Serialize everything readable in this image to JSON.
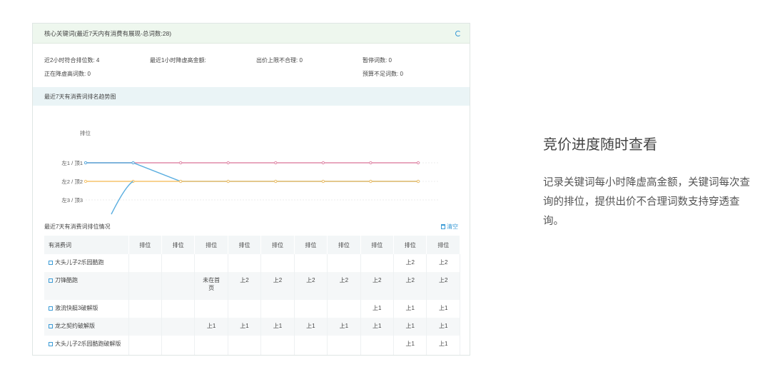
{
  "panel": {
    "title": "核心关键词(最近7天内有消费有展现-总词数:28)",
    "stats": {
      "rank_match": "近2小时符合排位数: 4",
      "bid_reduce_amount": "最近1小时降虚高金额:",
      "price_cap_invalid": "出价上限不合理: 0",
      "paused_words": "暂停词数: 0",
      "reducing_words": "正在降虚高词数: 0",
      "budget_short": "预算不足词数: 0"
    },
    "trend_section_title": "最近7天有消费词排名趋势图",
    "table_section_title": "最近7天有消费词排位情况",
    "clear_label": "清空"
  },
  "chart_data": {
    "type": "line",
    "ylabel": "排位",
    "y_ticks": [
      "左1 / 顶1",
      "左2 / 顶2",
      "左3 / 顶3"
    ],
    "series": [
      {
        "color": "#e08aa8",
        "values": [
          1,
          1,
          1,
          1,
          1,
          1,
          1,
          1
        ]
      },
      {
        "color": "#5aaee0",
        "values": [
          1,
          1,
          2,
          2,
          2,
          2,
          2,
          2
        ]
      },
      {
        "color": "#f5c36b",
        "values": [
          2,
          2,
          2,
          2,
          2,
          2,
          2,
          2
        ]
      }
    ]
  },
  "table": {
    "headers": [
      "有消费词",
      "排位",
      "排位",
      "排位",
      "排位",
      "排位",
      "排位",
      "排位",
      "排位",
      "排位",
      "排位"
    ],
    "rows": [
      [
        "大头儿子2乐园酷跑",
        "",
        "",
        "",
        "",
        "",
        "",
        "",
        "",
        "上2",
        "上2"
      ],
      [
        "刀锋酷跑",
        "",
        "",
        "未在首页",
        "上2",
        "上2",
        "上2",
        "上2",
        "上2",
        "上2",
        "上2"
      ],
      [
        "激流快艇3破解版",
        "",
        "",
        "",
        "",
        "",
        "",
        "",
        "上1",
        "上1",
        "上1"
      ],
      [
        "龙之契约破解版",
        "",
        "",
        "上1",
        "上1",
        "上1",
        "上1",
        "上1",
        "上1",
        "上1",
        "上1"
      ],
      [
        "大头儿子2乐园酷跑破解版",
        "",
        "",
        "",
        "",
        "",
        "",
        "",
        "",
        "上1",
        "上1"
      ]
    ]
  },
  "side": {
    "title": "竞价进度随时查看",
    "description": "记录关键词每小时降虚高金额，关键词每次查询的排位，提供出价不合理词数支持穿透查询。"
  },
  "icons": {
    "refresh": "refresh-icon",
    "trash": "trash-icon",
    "checkbox": "checkbox-icon"
  }
}
